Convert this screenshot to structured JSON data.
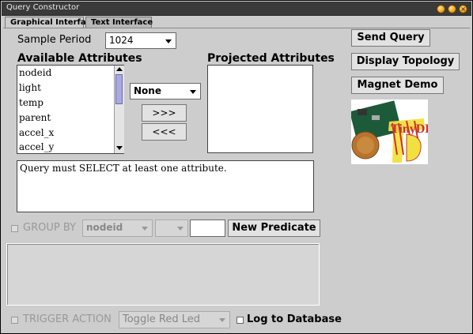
{
  "window": {
    "title": "Query Constructor"
  },
  "tabs": [
    {
      "label": "Graphical Interface",
      "active": true
    },
    {
      "label": "Text Interface",
      "active": false
    }
  ],
  "sample_period": {
    "label": "Sample Period",
    "value": "1024"
  },
  "available": {
    "label": "Available Attributes",
    "items": [
      "nodeid",
      "light",
      "temp",
      "parent",
      "accel_x",
      "accel_y"
    ]
  },
  "aggregate": {
    "value": "None"
  },
  "move": {
    "add_label": ">>>",
    "remove_label": "<<<"
  },
  "projected": {
    "label": "Projected Attributes"
  },
  "message": "Query must SELECT at least one attribute.",
  "group_by": {
    "label": "GROUP BY",
    "field": "nodeid",
    "op": "",
    "value": ""
  },
  "new_predicate_label": "New Predicate",
  "trigger": {
    "label": "TRIGGER ACTION",
    "action": "Toggle Red Led"
  },
  "log_label": "Log to Database",
  "side": {
    "send_query_label": "Send Query",
    "display_topology_label": "Display Topology",
    "magnet_demo_label": "Magnet Demo"
  },
  "logo": {
    "text": "TinyDB"
  },
  "colors": {
    "titlebar": "#3a3a3a",
    "panel": "#cdcdcd",
    "window_buttons": "#e69a12"
  }
}
